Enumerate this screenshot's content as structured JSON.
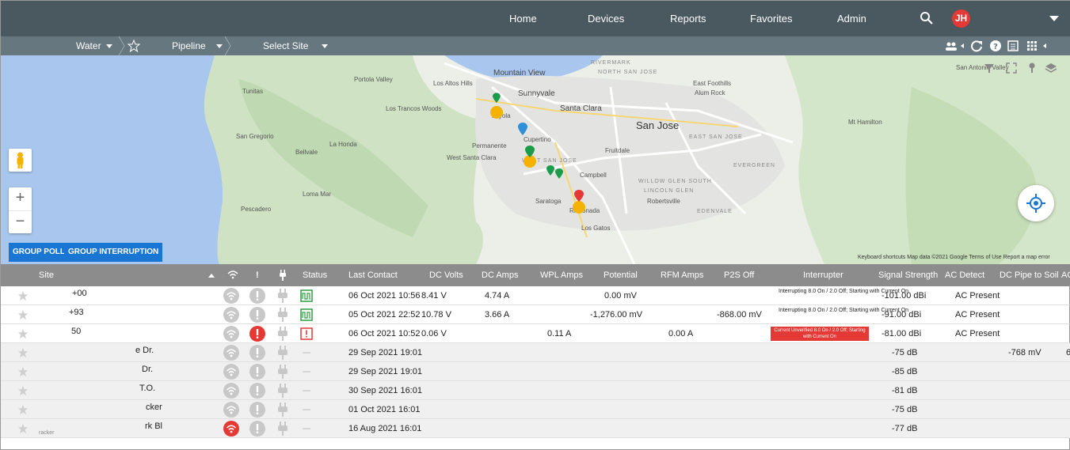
{
  "topnav": {
    "items": [
      "Home",
      "Devices",
      "Reports",
      "Favorites",
      "Admin"
    ],
    "avatar_initials": "JH"
  },
  "subnav": {
    "water": "Water",
    "pipeline": "Pipeline",
    "select_site": "Select Site"
  },
  "map": {
    "labels": {
      "mountain_view": "Mountain View",
      "sunnyvale": "Sunnyvale",
      "santa_clara": "Santa Clara",
      "san_jose": "San Jose",
      "cupertino": "Cupertino",
      "campbell": "Campbell",
      "saratoga": "Saratoga",
      "los_gatos": "Los Gatos",
      "los_altos_hills": "Los Altos Hills",
      "portola_valley": "Portola Valley",
      "tunitas": "Tunitas",
      "san_gregorio": "San Gregorio",
      "la_honda": "La Honda",
      "bellvale": "Bellvale",
      "loma_mar": "Loma Mar",
      "pescadero": "Pescadero",
      "los_trancos": "Los Trancos Woods",
      "permanente": "Permanente",
      "west_santa_clara": "West Santa Clara",
      "fruitdale": "Fruitdale",
      "robertsville": "Robertsville",
      "rinconada": "Rinconada",
      "loyola": "Loyola",
      "east_foothills": "East Foothills",
      "alum_rock": "Alum Rock",
      "mt_hamilton": "Mt Hamilton",
      "san_antonio_valley": "San Antonio Valley",
      "rivermark": "RIVERMARK",
      "north_san_jose": "NORTH SAN JOSE",
      "east_san_jose": "EAST SAN JOSE",
      "evergreen": "EVERGREEN",
      "west_san_jose": "WEST SAN JOSE",
      "willow_glen_south": "WILLOW GLEN SOUTH",
      "lincoln_glen": "LINCOLN GLEN",
      "edenvale": "EDENVALE"
    },
    "group_poll": "GROUP POLL",
    "group_interruption": "GROUP INTERRUPTION",
    "attribution": "Keyboard shortcuts   Map data ©2021 Google   Terms of Use   Report a map error"
  },
  "table": {
    "headers": {
      "site": "Site",
      "status": "Status",
      "last_contact": "Last Contact",
      "dc_volts": "DC Volts",
      "dc_amps": "DC Amps",
      "wpl_amps": "WPL Amps",
      "potential": "Potential",
      "rfm_amps": "RFM Amps",
      "p2s_off": "P2S Off",
      "interrupter": "Interrupter",
      "signal_strength": "Signal Strength",
      "ac_detect": "AC Detect",
      "dc_pipe_to_soil": "DC Pipe to Soil",
      "ac_cut": "AC"
    },
    "rows": [
      {
        "site": "+00",
        "site_sub": "",
        "status": "pulse",
        "wifi": "grey",
        "alert": "grey",
        "last_contact": "06 Oct 2021 10:56",
        "dc_volts": "8.41 V",
        "dc_amps": "4.74 A",
        "wpl_amps": "",
        "potential": "0.00 mV",
        "rfm_amps": "",
        "p2s_off": "",
        "interrupter": "Interrupting 8.0 On / 2.0 Off; Starting with Current On",
        "interrupter_alert": false,
        "signal": "-101.00 dBi",
        "ac_detect": "AC Present",
        "dc_pts": "",
        "ac_cut": ""
      },
      {
        "site": "+93",
        "site_sub": "",
        "status": "pulse",
        "wifi": "grey",
        "alert": "grey",
        "last_contact": "05 Oct 2021 22:52",
        "dc_volts": "10.78 V",
        "dc_amps": "3.66 A",
        "wpl_amps": "",
        "potential": "-1,276.00 mV",
        "rfm_amps": "",
        "p2s_off": "-868.00 mV",
        "interrupter": "Interrupting 8.0 On / 2.0 Off; Starting with Current On",
        "interrupter_alert": false,
        "signal": "-91.00 dBi",
        "ac_detect": "AC Present",
        "dc_pts": "",
        "ac_cut": ""
      },
      {
        "site": "50",
        "site_sub": "",
        "status": "alert",
        "wifi": "grey",
        "alert": "red",
        "last_contact": "06 Oct 2021 10:52",
        "dc_volts": "0.06 V",
        "dc_amps": "",
        "wpl_amps": "0.11 A",
        "potential": "",
        "rfm_amps": "0.00 A",
        "p2s_off": "",
        "interrupter": "Current Unverified 8.0 On / 2.0 Off; Starting with Current On",
        "interrupter_alert": true,
        "signal": "-81.00 dBi",
        "ac_detect": "AC Present",
        "dc_pts": "",
        "ac_cut": ""
      },
      {
        "site": "e Dr.",
        "site_sub": "",
        "status": "none",
        "wifi": "grey",
        "alert": "grey",
        "last_contact": "29 Sep 2021 19:01",
        "dc_volts": "",
        "dc_amps": "",
        "wpl_amps": "",
        "potential": "",
        "rfm_amps": "",
        "p2s_off": "",
        "interrupter": "",
        "interrupter_alert": false,
        "signal": "-75 dB",
        "ac_detect": "",
        "dc_pts": "-768 mV",
        "ac_cut": "6"
      },
      {
        "site": "Dr.",
        "site_sub": "",
        "status": "none",
        "wifi": "grey",
        "alert": "grey",
        "last_contact": "29 Sep 2021 19:01",
        "dc_volts": "",
        "dc_amps": "",
        "wpl_amps": "",
        "potential": "",
        "rfm_amps": "",
        "p2s_off": "",
        "interrupter": "",
        "interrupter_alert": false,
        "signal": "-85 dB",
        "ac_detect": "",
        "dc_pts": "",
        "ac_cut": ""
      },
      {
        "site": "T.O.",
        "site_sub": "",
        "status": "none",
        "wifi": "grey",
        "alert": "grey",
        "last_contact": "30 Sep 2021 16:01",
        "dc_volts": "",
        "dc_amps": "",
        "wpl_amps": "",
        "potential": "",
        "rfm_amps": "",
        "p2s_off": "",
        "interrupter": "",
        "interrupter_alert": false,
        "signal": "-81 dB",
        "ac_detect": "",
        "dc_pts": "",
        "ac_cut": ""
      },
      {
        "site": "cker",
        "site_sub": "",
        "status": "none",
        "wifi": "grey",
        "alert": "grey",
        "last_contact": "01 Oct 2021 16:01",
        "dc_volts": "",
        "dc_amps": "",
        "wpl_amps": "",
        "potential": "",
        "rfm_amps": "",
        "p2s_off": "",
        "interrupter": "",
        "interrupter_alert": false,
        "signal": "-75 dB",
        "ac_detect": "",
        "dc_pts": "",
        "ac_cut": ""
      },
      {
        "site": "rk Bl",
        "site_sub": "racker",
        "status": "none",
        "wifi": "red",
        "alert": "grey",
        "last_contact": "16 Aug 2021 16:01",
        "dc_volts": "",
        "dc_amps": "",
        "wpl_amps": "",
        "potential": "",
        "rfm_amps": "",
        "p2s_off": "",
        "interrupter": "",
        "interrupter_alert": false,
        "signal": "-77 dB",
        "ac_detect": "",
        "dc_pts": "",
        "ac_cut": ""
      }
    ]
  },
  "colors": {
    "topbar": "#4a5860",
    "subbar": "#66777f",
    "table_header": "#8c8c8c",
    "accent_blue": "#1976d2",
    "alert_red": "#e53935",
    "status_green": "#2e9e44"
  },
  "icons": [
    "search-icon",
    "user-group-icon",
    "refresh-icon",
    "help-icon",
    "list-icon",
    "grid-icon",
    "star-icon",
    "pegman-icon",
    "locate-icon",
    "layers-icon",
    "wifi-icon",
    "alert-icon",
    "plug-icon",
    "pulse-status-icon",
    "map-pin-icon"
  ]
}
